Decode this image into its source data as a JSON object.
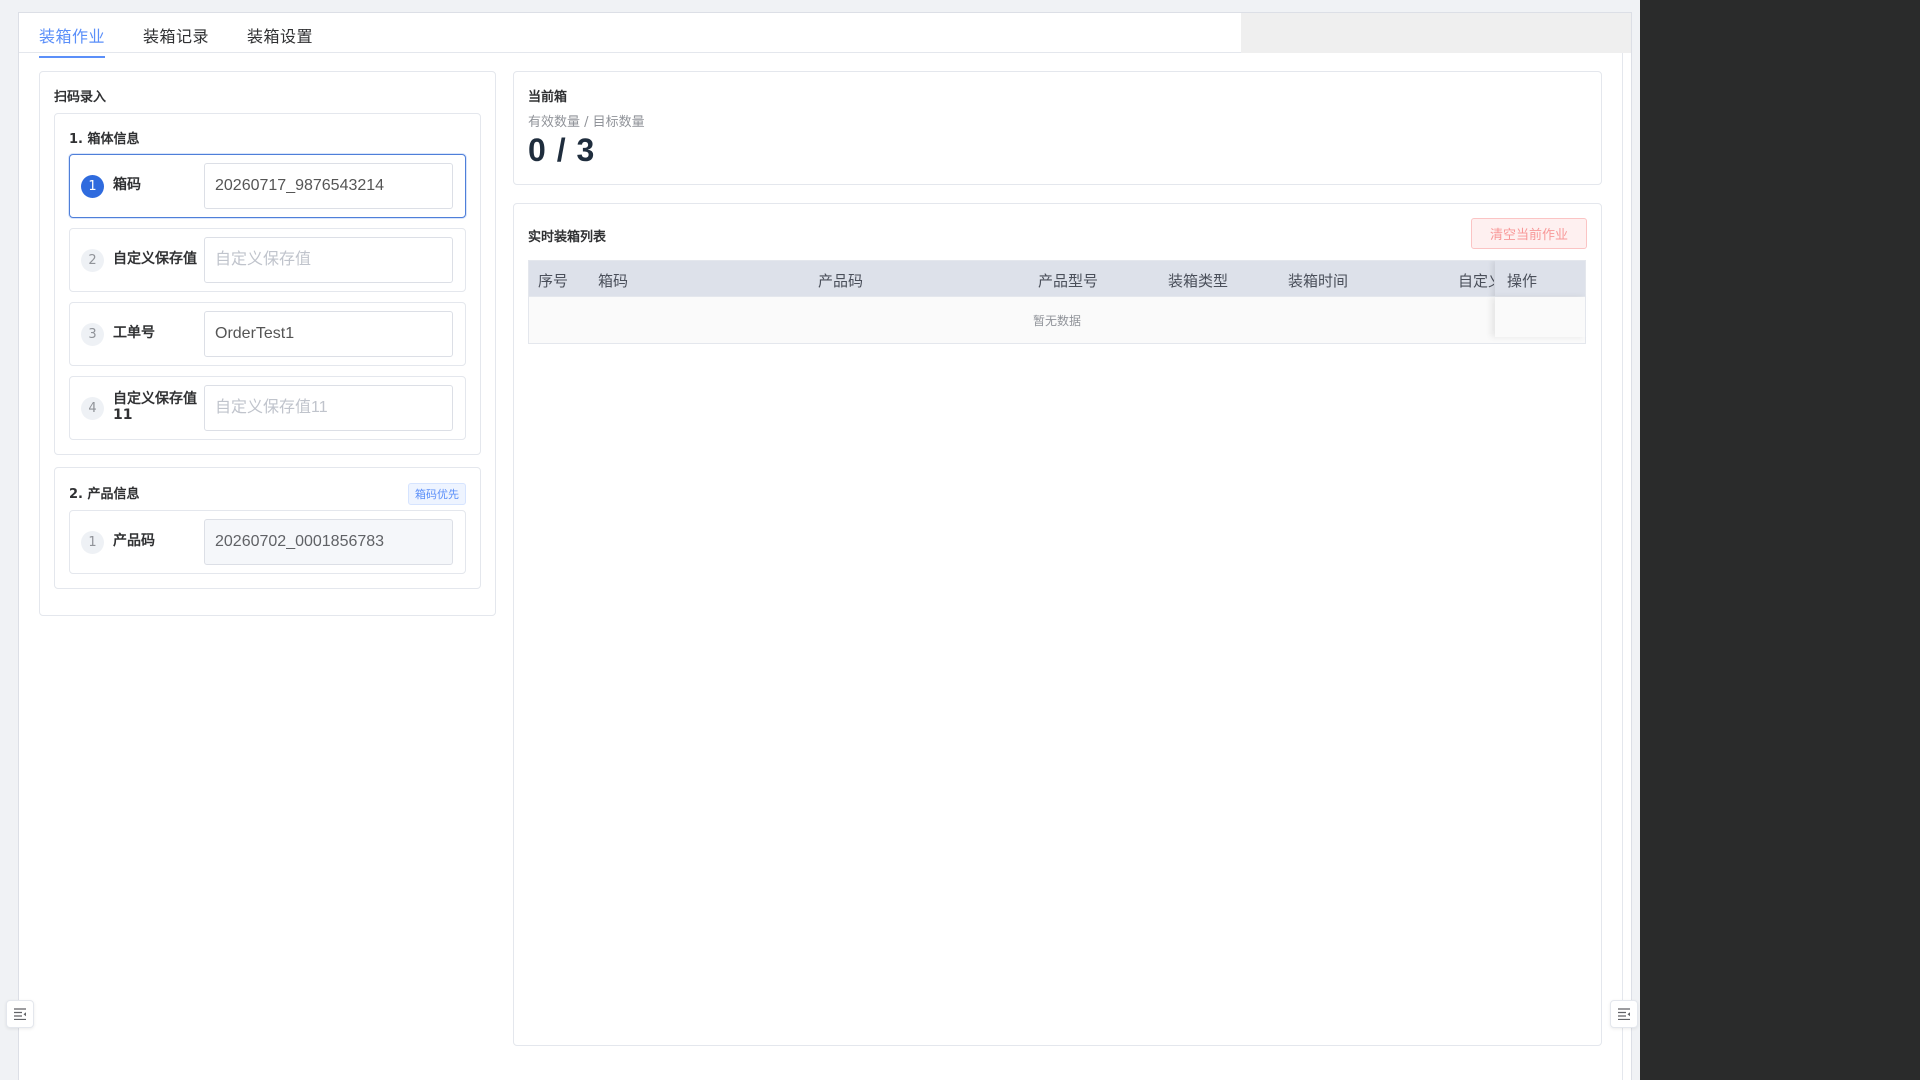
{
  "tabs": [
    {
      "label": "装箱作业",
      "active": true
    },
    {
      "label": "装箱记录",
      "active": false
    },
    {
      "label": "装箱设置",
      "active": false
    }
  ],
  "scan_panel": {
    "title": "扫码录入",
    "box_section": {
      "title": "1. 箱体信息",
      "fields": [
        {
          "index": "1",
          "label": "箱码",
          "value": "20260717_9876543214",
          "placeholder": ""
        },
        {
          "index": "2",
          "label": "自定义保存值",
          "value": "",
          "placeholder": "自定义保存值"
        },
        {
          "index": "3",
          "label": "工单号",
          "value": "OrderTest1",
          "placeholder": ""
        },
        {
          "index": "4",
          "label": "自定义保存值11",
          "value": "",
          "placeholder": "自定义保存值11"
        }
      ]
    },
    "product_section": {
      "title": "2. 产品信息",
      "badge": "箱码优先",
      "fields": [
        {
          "index": "1",
          "label": "产品码",
          "value": "20260702_0001856783",
          "placeholder": ""
        }
      ]
    }
  },
  "current_box": {
    "title": "当前箱",
    "subtitle": "有效数量 / 目标数量",
    "count": "0 / 3"
  },
  "realtime_list": {
    "title": "实时装箱列表",
    "clear_button": "清空当前作业",
    "columns": [
      "序号",
      "箱码",
      "产品码",
      "产品型号",
      "装箱类型",
      "装箱时间",
      "自定义",
      "操作"
    ],
    "empty_text": "暂无数据"
  },
  "colors": {
    "accent": "#5b8ff9",
    "active_step": "#2f6bde",
    "danger_light": "#fef0f0"
  },
  "icons": {
    "left_toggle": "menu-collapse-icon",
    "right_toggle": "menu-collapse-icon"
  }
}
